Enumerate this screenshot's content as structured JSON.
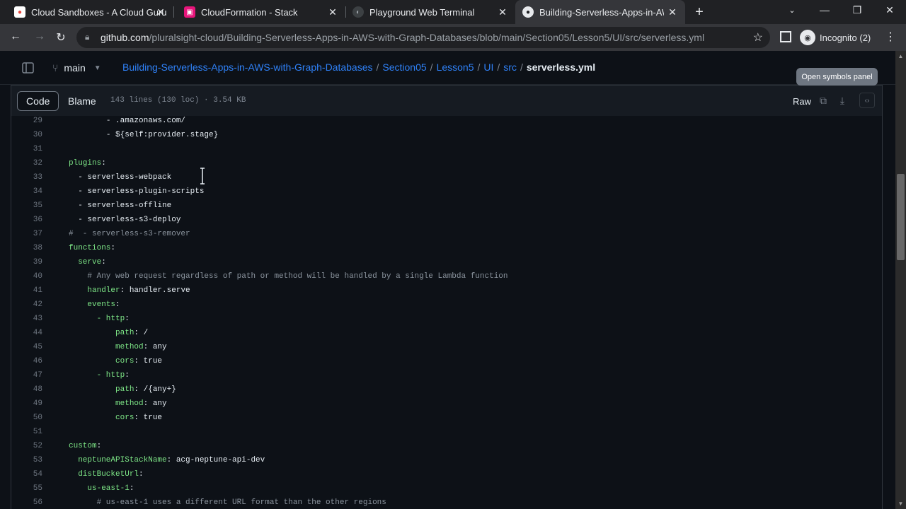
{
  "browser": {
    "tabs": [
      {
        "title": "Cloud Sandboxes - A Cloud Guru",
        "icon": "acg-icon",
        "active": false
      },
      {
        "title": "CloudFormation - Stack",
        "icon": "cloudformation-icon",
        "active": false
      },
      {
        "title": "Playground Web Terminal",
        "icon": "terminal-icon",
        "active": false
      },
      {
        "title": "Building-Serverless-Apps-in-AWS",
        "icon": "github-icon",
        "active": true
      }
    ],
    "url_host": "github.com",
    "url_path": "/pluralsight-cloud/Building-Serverless-Apps-in-AWS-with-Graph-Databases/blob/main/Section05/Lesson5/UI/src/serverless.yml",
    "profile_label": "Incognito (2)"
  },
  "repo": {
    "branch": "main",
    "breadcrumbs": [
      "Building-Serverless-Apps-in-AWS-with-Graph-Databases",
      "Section05",
      "Lesson5",
      "UI",
      "src"
    ],
    "filename": "serverless.yml",
    "tooltip": "Open symbols panel"
  },
  "file": {
    "code_tab": "Code",
    "blame_tab": "Blame",
    "info": "143 lines (130 loc) · 3.54 KB",
    "raw_label": "Raw"
  },
  "code_lines": [
    {
      "n": "29",
      "indent": "        ",
      "key": "",
      "text": "- .amazonaws.com/",
      "kind": "v"
    },
    {
      "n": "30",
      "indent": "        ",
      "key": "",
      "text": "- ${self:provider.stage}",
      "kind": "v"
    },
    {
      "n": "31",
      "indent": "",
      "key": "",
      "text": "",
      "kind": "v"
    },
    {
      "n": "32",
      "indent": "",
      "key": "plugins",
      "text": ":",
      "kind": "k"
    },
    {
      "n": "33",
      "indent": "  ",
      "key": "",
      "text": "- serverless-webpack",
      "kind": "v"
    },
    {
      "n": "34",
      "indent": "  ",
      "key": "",
      "text": "- serverless-plugin-scripts",
      "kind": "v"
    },
    {
      "n": "35",
      "indent": "  ",
      "key": "",
      "text": "- serverless-offline",
      "kind": "v"
    },
    {
      "n": "36",
      "indent": "  ",
      "key": "",
      "text": "- serverless-s3-deploy",
      "kind": "v"
    },
    {
      "n": "37",
      "indent": "",
      "key": "",
      "text": "#  - serverless-s3-remover",
      "kind": "c"
    },
    {
      "n": "38",
      "indent": "",
      "key": "functions",
      "text": ":",
      "kind": "k"
    },
    {
      "n": "39",
      "indent": "  ",
      "key": "serve",
      "text": ":",
      "kind": "k"
    },
    {
      "n": "40",
      "indent": "    ",
      "key": "",
      "text": "# Any web request regardless of path or method will be handled by a single Lambda function",
      "kind": "c"
    },
    {
      "n": "41",
      "indent": "    ",
      "key": "handler",
      "text": ": handler.serve",
      "kind": "k"
    },
    {
      "n": "42",
      "indent": "    ",
      "key": "events",
      "text": ":",
      "kind": "k"
    },
    {
      "n": "43",
      "indent": "      ",
      "key": "- http",
      "text": ":",
      "kind": "kd"
    },
    {
      "n": "44",
      "indent": "          ",
      "key": "path",
      "text": ": /",
      "kind": "k"
    },
    {
      "n": "45",
      "indent": "          ",
      "key": "method",
      "text": ": any",
      "kind": "k"
    },
    {
      "n": "46",
      "indent": "          ",
      "key": "cors",
      "text": ": true",
      "kind": "k"
    },
    {
      "n": "47",
      "indent": "      ",
      "key": "- http",
      "text": ":",
      "kind": "kd"
    },
    {
      "n": "48",
      "indent": "          ",
      "key": "path",
      "text": ": /{any+}",
      "kind": "k"
    },
    {
      "n": "49",
      "indent": "          ",
      "key": "method",
      "text": ": any",
      "kind": "k"
    },
    {
      "n": "50",
      "indent": "          ",
      "key": "cors",
      "text": ": true",
      "kind": "k"
    },
    {
      "n": "51",
      "indent": "",
      "key": "",
      "text": "",
      "kind": "v"
    },
    {
      "n": "52",
      "indent": "",
      "key": "custom",
      "text": ":",
      "kind": "k"
    },
    {
      "n": "53",
      "indent": "  ",
      "key": "neptuneAPIStackName",
      "text": ": acg-neptune-api-dev",
      "kind": "k"
    },
    {
      "n": "54",
      "indent": "  ",
      "key": "distBucketUrl",
      "text": ":",
      "kind": "k"
    },
    {
      "n": "55",
      "indent": "    ",
      "key": "us-east-1",
      "text": ":",
      "kind": "k"
    },
    {
      "n": "56",
      "indent": "      ",
      "key": "",
      "text": "# us-east-1 uses a different URL format than the other regions",
      "kind": "c"
    }
  ],
  "colors": {
    "key": "#7ee787",
    "comment": "#8b949e",
    "link": "#2f81f7"
  }
}
